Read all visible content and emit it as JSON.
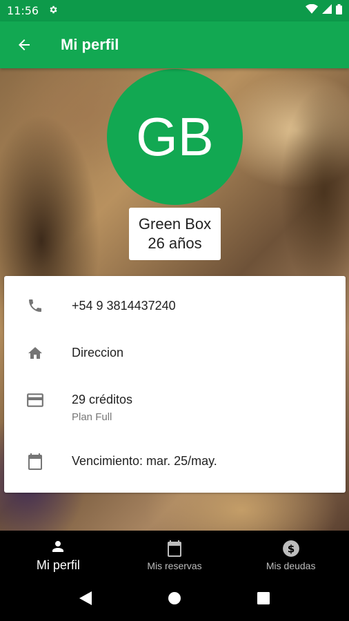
{
  "status_bar": {
    "time": "11:56",
    "icons": [
      "gear-icon",
      "wifi-icon",
      "signal-icon",
      "battery-icon"
    ]
  },
  "app_bar": {
    "title": "Mi perfil",
    "back_icon": "arrow-left-icon"
  },
  "profile": {
    "initials": "GB",
    "name": "Green Box",
    "age": "26 años",
    "avatar_color": "#12a852"
  },
  "info": {
    "phone": "+54 9 3814437240",
    "address": "Direccion",
    "credits": "29 créditos",
    "plan": "Plan Full",
    "expiry": "Vencimiento: mar. 25/may."
  },
  "bottom_nav": {
    "items": [
      {
        "label": "Mi perfil",
        "icon": "person-icon",
        "active": true
      },
      {
        "label": "Mis reservas",
        "icon": "calendar-icon",
        "active": false
      },
      {
        "label": "Mis deudas",
        "icon": "dollar-circle-icon",
        "active": false
      }
    ]
  },
  "colors": {
    "primary": "#12a852",
    "status_bar": "#0d9a4a",
    "icon_gray": "#757575"
  }
}
